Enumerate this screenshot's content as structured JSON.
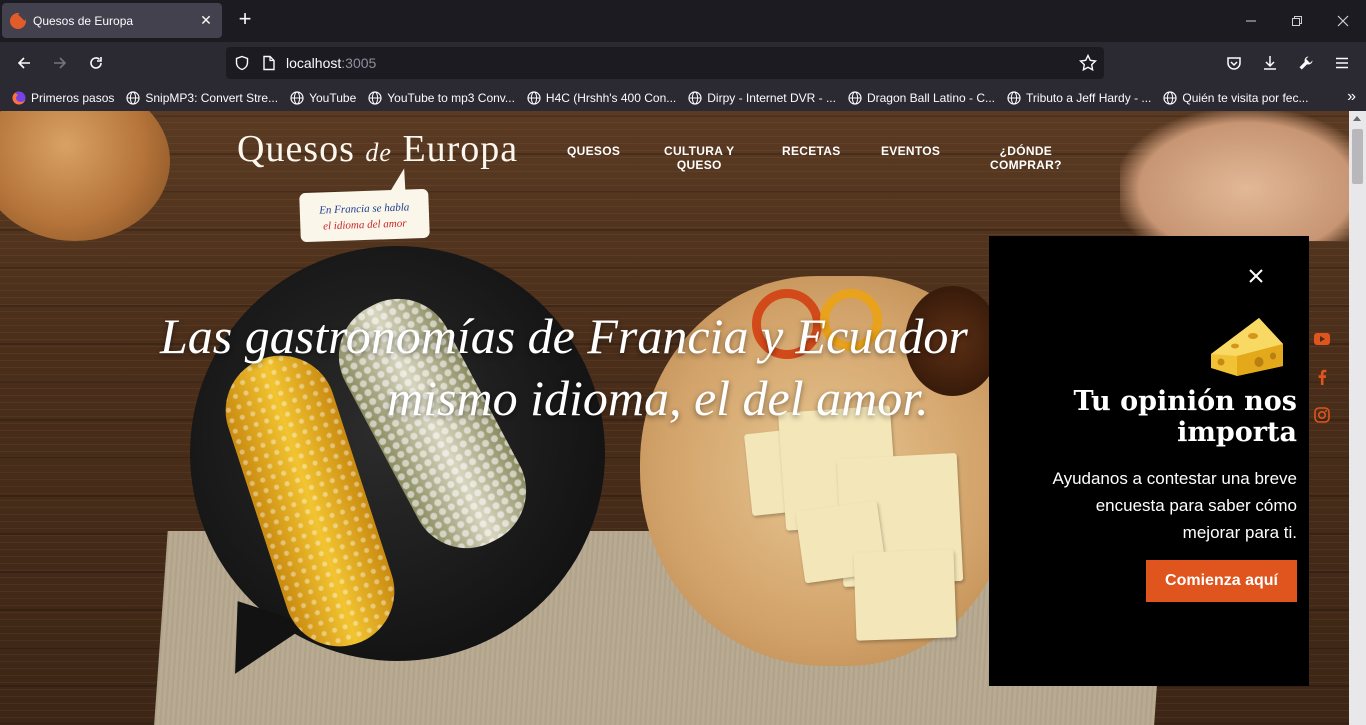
{
  "browser": {
    "tab_title": "Quesos de Europa",
    "tab_close": "✕",
    "new_tab": "+",
    "url_host": "localhost",
    "url_port": ":3005",
    "bookmarks": [
      {
        "label": "Primeros pasos",
        "icon": "firefox-icon"
      },
      {
        "label": "SnipMP3: Convert Stre...",
        "icon": "globe-icon"
      },
      {
        "label": "YouTube",
        "icon": "globe-icon"
      },
      {
        "label": "YouTube to mp3 Conv...",
        "icon": "globe-icon"
      },
      {
        "label": "H4C (Hrshh's 400 Con...",
        "icon": "globe-icon"
      },
      {
        "label": "Dirpy - Internet DVR - ...",
        "icon": "globe-icon"
      },
      {
        "label": "Dragon Ball Latino - C...",
        "icon": "globe-icon"
      },
      {
        "label": "Tributo a Jeff Hardy - ...",
        "icon": "globe-icon"
      },
      {
        "label": "Quién te visita por fec...",
        "icon": "globe-icon"
      }
    ],
    "bookmarks_more": "»"
  },
  "site": {
    "logo_left": "Quesos",
    "logo_de": "de",
    "logo_right": "Europa",
    "bubble_line1": "En Francia se habla",
    "bubble_line2": "el idioma del amor",
    "nav": {
      "quesos": "QUESOS",
      "cultura_1": "CULTURA Y",
      "cultura_2": "QUESO",
      "recetas": "RECETAS",
      "eventos": "EVENTOS",
      "donde_1": "¿DÓNDE",
      "donde_2": "COMPRAR?"
    },
    "hero_line1": "Las gastronomías de Francia y Ecuador",
    "hero_line2": "mismo idioma, el del amor."
  },
  "popup": {
    "heading_line1": "Tu opinión nos",
    "heading_line2": "importa",
    "body_line1": "Ayudanos a contestar una breve",
    "body_line2": "encuesta para saber cómo",
    "body_line3": "mejorar para ti.",
    "cta": "Comienza aquí"
  },
  "colors": {
    "accent": "#e0541e",
    "chrome_dark": "#1c1b22",
    "chrome_toolbar": "#2b2a33"
  }
}
